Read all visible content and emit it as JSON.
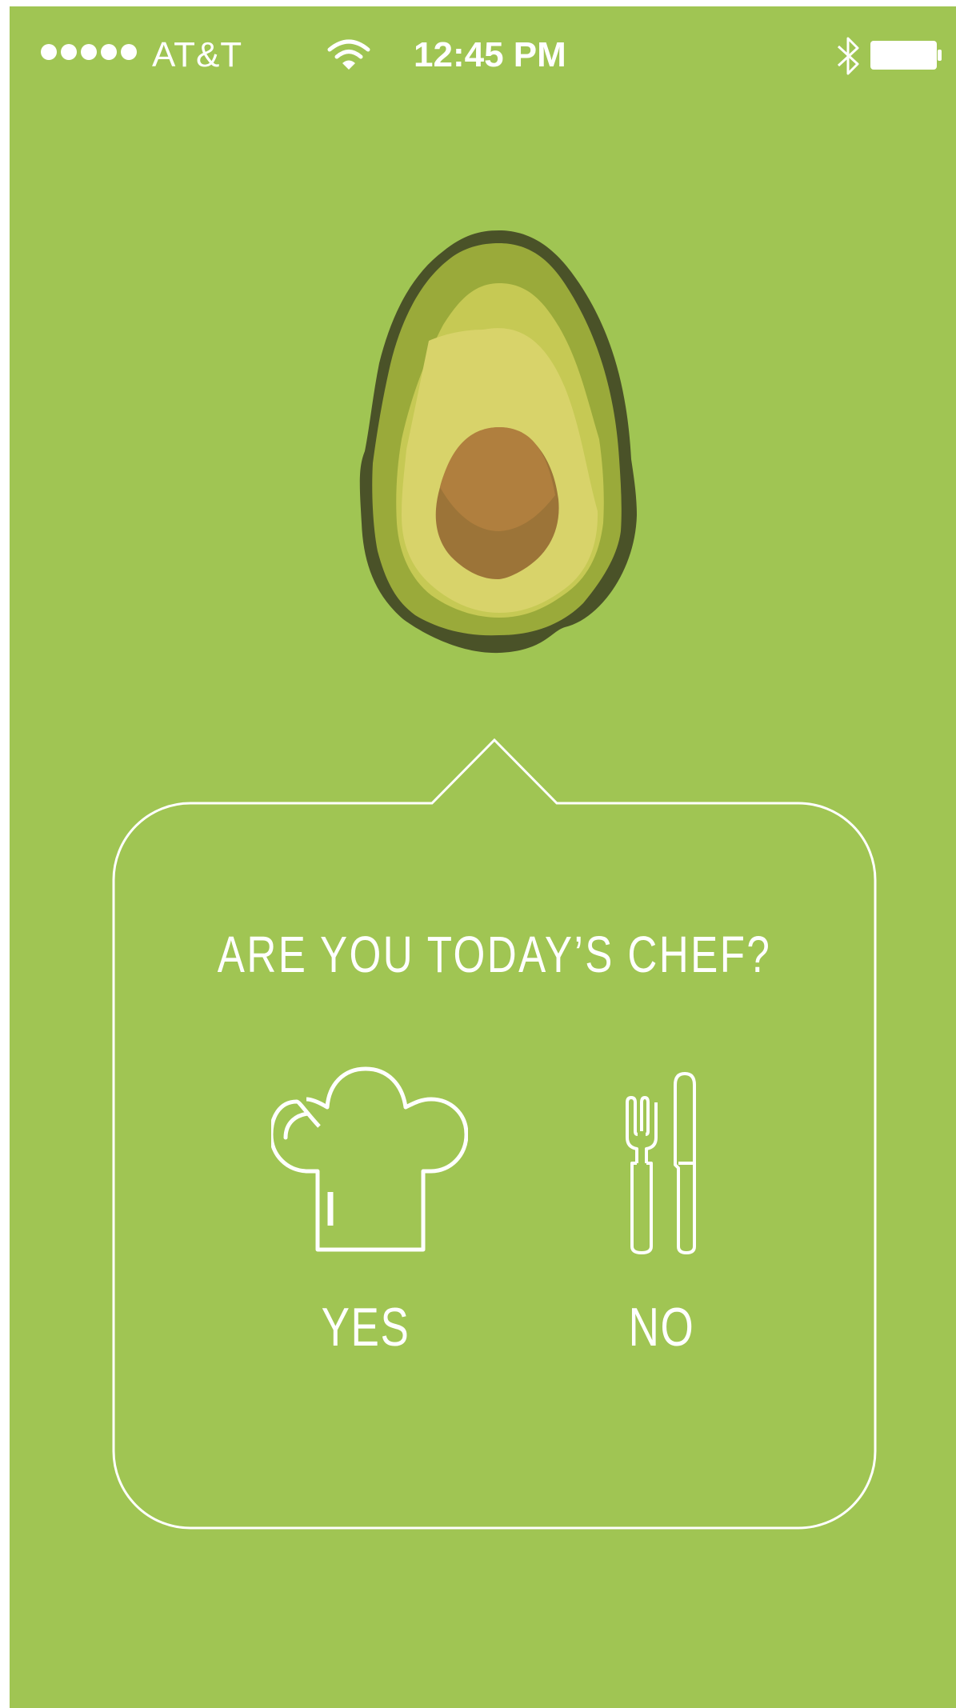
{
  "status_bar": {
    "carrier": "AT&T",
    "time": "12:45 PM",
    "signal_strength": 5,
    "battery_level": 1.0
  },
  "colors": {
    "background": "#a0c553",
    "foreground": "#ffffff",
    "avocado_outline": "#4a5228",
    "avocado_skin": "#9aaa3a",
    "avocado_flesh_outer": "#c6c954",
    "avocado_flesh_inner": "#d8d36a",
    "avocado_pit": "#b07f3e",
    "avocado_pit_shadow": "#9c7438"
  },
  "prompt": {
    "question": "ARE YOU TODAY’S CHEF?",
    "yes_label": "YES",
    "no_label": "NO"
  },
  "icons": {
    "signal": "signal-dots-icon",
    "wifi": "wifi-icon",
    "bluetooth": "bluetooth-icon",
    "battery": "battery-icon",
    "illustration": "avocado-illustration",
    "yes": "chef-hat-icon",
    "no": "fork-knife-icon"
  }
}
